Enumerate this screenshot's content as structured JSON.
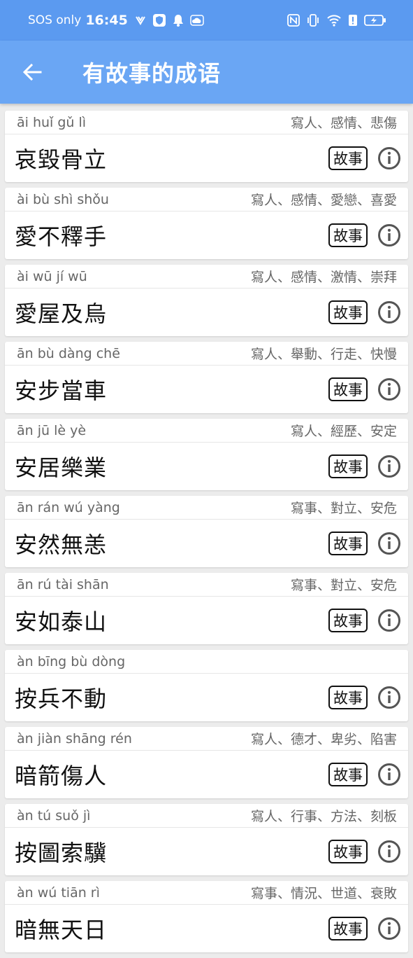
{
  "status": {
    "carrier": "SOS only",
    "time": "16:45",
    "icons": [
      "vibrate-icon",
      "shield-icon",
      "bell-icon",
      "cloud-icon"
    ],
    "right_icons": [
      "nfc-icon",
      "vibrate-mode-icon",
      "wifi-icon",
      "alert-icon",
      "battery-charging-icon"
    ]
  },
  "appbar": {
    "title": "有故事的成语"
  },
  "story_label": "故事",
  "items": [
    {
      "pinyin": "āi huǐ gǔ lì",
      "tags": "寫人、感情、悲傷",
      "idiom": "哀毀骨立"
    },
    {
      "pinyin": "ài bù shì shǒu",
      "tags": "寫人、感情、愛戀、喜愛",
      "idiom": "愛不釋手"
    },
    {
      "pinyin": "ài wū jí wū",
      "tags": "寫人、感情、激情、崇拜",
      "idiom": "愛屋及烏"
    },
    {
      "pinyin": "ān bù dàng chē",
      "tags": "寫人、舉動、行走、快慢",
      "idiom": "安步當車"
    },
    {
      "pinyin": "ān jū lè yè",
      "tags": "寫人、經歷、安定",
      "idiom": "安居樂業"
    },
    {
      "pinyin": "ān rán wú yàng",
      "tags": "寫事、對立、安危",
      "idiom": "安然無恙"
    },
    {
      "pinyin": "ān rú tài shān",
      "tags": "寫事、對立、安危",
      "idiom": "安如泰山"
    },
    {
      "pinyin": "àn bīng bù dòng",
      "tags": "",
      "idiom": "按兵不動"
    },
    {
      "pinyin": "àn jiàn shāng rén",
      "tags": "寫人、德才、卑劣、陷害",
      "idiom": "暗箭傷人"
    },
    {
      "pinyin": "àn tú suǒ jì",
      "tags": "寫人、行事、方法、刻板",
      "idiom": "按圖索驥"
    },
    {
      "pinyin": "àn wú tiān rì",
      "tags": "寫事、情況、世道、衰敗",
      "idiom": "暗無天日"
    }
  ]
}
